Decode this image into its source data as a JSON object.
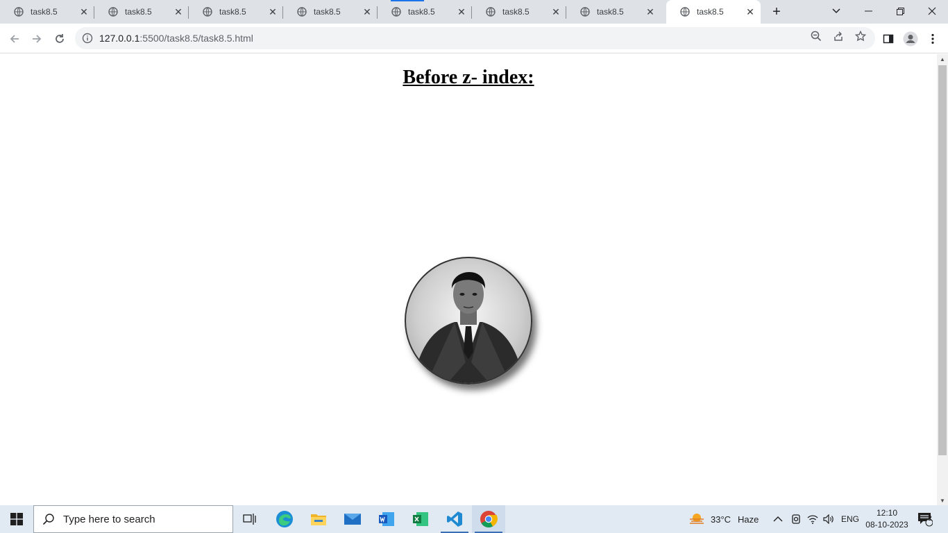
{
  "browser": {
    "tabs": [
      {
        "title": "task8.5"
      },
      {
        "title": "task8.5"
      },
      {
        "title": "task8.5"
      },
      {
        "title": "task8.5"
      },
      {
        "title": "task8.5"
      },
      {
        "title": "task8.5"
      },
      {
        "title": "task8.5"
      },
      {
        "title": "task8.5",
        "active": true
      }
    ],
    "url_host": "127.0.0.1",
    "url_path": ":5500/task8.5/task8.5.html"
  },
  "page": {
    "heading": "Before z- index:",
    "image_subject": "portrait-photo"
  },
  "taskbar": {
    "search_placeholder": "Type here to search",
    "weather_temp": "33°C",
    "weather_desc": "Haze",
    "language": "ENG",
    "time": "12:10",
    "date": "08-10-2023",
    "notification_count": "2"
  },
  "colors": {
    "tabstrip_bg": "#dee1e6",
    "accent": "#1a73e8",
    "taskbar_bg": "#e1e9f2"
  }
}
